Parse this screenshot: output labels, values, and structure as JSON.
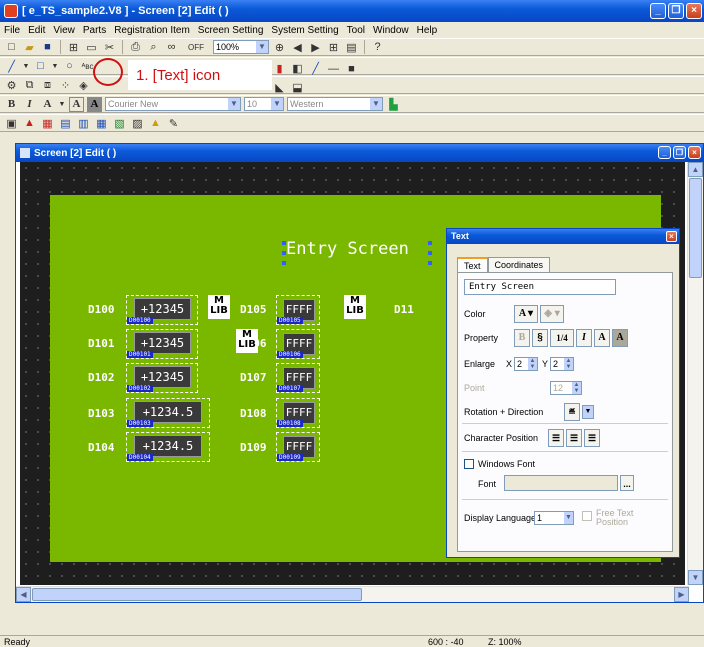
{
  "window": {
    "title": "[ e_TS_sample2.V8 ] - Screen [2] Edit (            )"
  },
  "menu": [
    "File",
    "Edit",
    "View",
    "Parts",
    "Registration Item",
    "Screen Setting",
    "System Setting",
    "Tool",
    "Window",
    "Help"
  ],
  "toolbar": {
    "zoom": "100%",
    "font_name": "Courier New",
    "font_size": "10",
    "charset": "Western",
    "off_label": "OFF"
  },
  "callout": {
    "text": "1.  [Text] icon"
  },
  "editor": {
    "title": "Screen [2] Edit (            )",
    "entry_text": "Entry Screen",
    "left_labels": [
      "D100",
      "D101",
      "D102",
      "D103",
      "D104"
    ],
    "left_values": [
      "+12345",
      "+12345",
      "+12345",
      "+1234.5",
      "+1234.5"
    ],
    "left_tags": [
      "D00100",
      "D00101",
      "D00102",
      "D00103",
      "D00104"
    ],
    "right_labels": [
      "D105",
      "D106",
      "D107",
      "D108",
      "D109"
    ],
    "right_values": [
      "FFFF",
      "FFFF",
      "FFFF",
      "FFFF",
      "FFFF"
    ],
    "right_tags": [
      "D00105",
      "D00106",
      "D00107",
      "D00108",
      "D00109"
    ],
    "extra_label": "D11",
    "mlib": "LIB"
  },
  "dialog": {
    "title": "Text",
    "tabs": [
      "Text",
      "Coordinates"
    ],
    "text_value": "Entry Screen",
    "color_label": "Color",
    "property_label": "Property",
    "property_buttons": [
      "B",
      "§",
      "1/4",
      "I",
      "A",
      "A"
    ],
    "enlarge_label": "Enlarge",
    "x_label": "X",
    "x_value": "2",
    "y_label": "Y",
    "y_value": "2",
    "point_label": "Point",
    "point_value": "12",
    "rotation_label": "Rotation + Direction",
    "charpos_label": "Character Position",
    "windows_font_label": "Windows Font",
    "font_label": "Font",
    "font_browse": "...",
    "display_language_label": "Display Language",
    "display_language_value": "1",
    "free_text_label": "Free Text Position"
  },
  "status": {
    "left": "Ready",
    "coords": "600 : -40",
    "zoom": "Z: 100%"
  }
}
